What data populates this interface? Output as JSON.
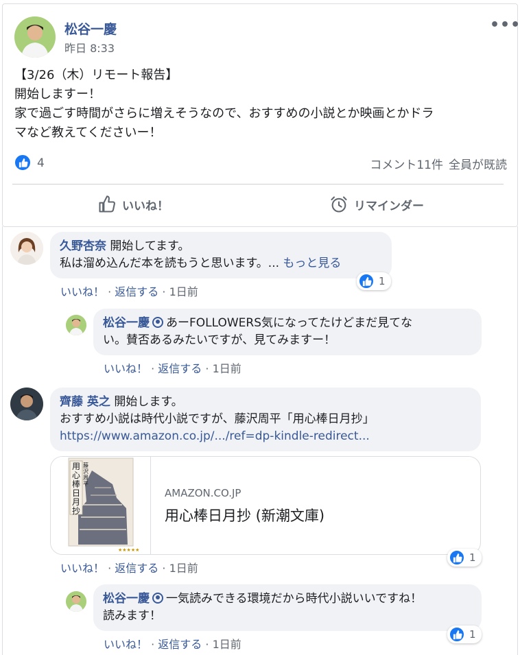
{
  "post": {
    "author": "松谷一慶",
    "time": "昨日 8:33",
    "more": "•••",
    "lines": [
      "【3/26（木）リモート報告】",
      "開始しますー！",
      "家で過ごす時間がさらに増えそうなので、おすすめの小説とか映画とかドラ",
      "マなど教えてくださいー！"
    ],
    "reactions": "4",
    "comments": "コメント11件",
    "seen": "全員が既読"
  },
  "actions": {
    "like": "いいね！",
    "reminder": "リマインダー"
  },
  "meta": {
    "like": "いいね！",
    "reply": "返信する",
    "sep": " · ",
    "when": "1日前"
  },
  "comments": [
    {
      "name": "久野杏奈",
      "text": "開始してます。",
      "line2": "私は溜め込んだ本を読もうと思います。... ",
      "see_more": "もっと見る",
      "reactions": "1"
    },
    {
      "name": "松谷一慶",
      "text": "あーFOLLOWERS気になってたけどまだ見てな",
      "line2": "い。賛否あるみたいですが、見てみますー！"
    },
    {
      "name": "齊藤 英之",
      "text": "開始します。",
      "line2": "おすすめ小説は時代小説ですが、藤沢周平「用心棒日月抄」",
      "link": "https://www.amazon.co.jp/.../ref=dp-kindle-redirect...",
      "reactions": "1",
      "preview": {
        "domain": "AMAZON.CO.JP",
        "title": "用心棒日月抄 (新潮文庫)",
        "cover_title": "用心棒日月抄",
        "cover_author": "藤沢周平"
      }
    },
    {
      "name": "松谷一慶",
      "text": "一気読みできる環境だから時代小説いいですね！",
      "line2": "読みます！",
      "reactions": "1"
    }
  ],
  "colors": {
    "link": "#385898",
    "like_blue": "#1877f2",
    "bubble": "#f0f2f5"
  }
}
